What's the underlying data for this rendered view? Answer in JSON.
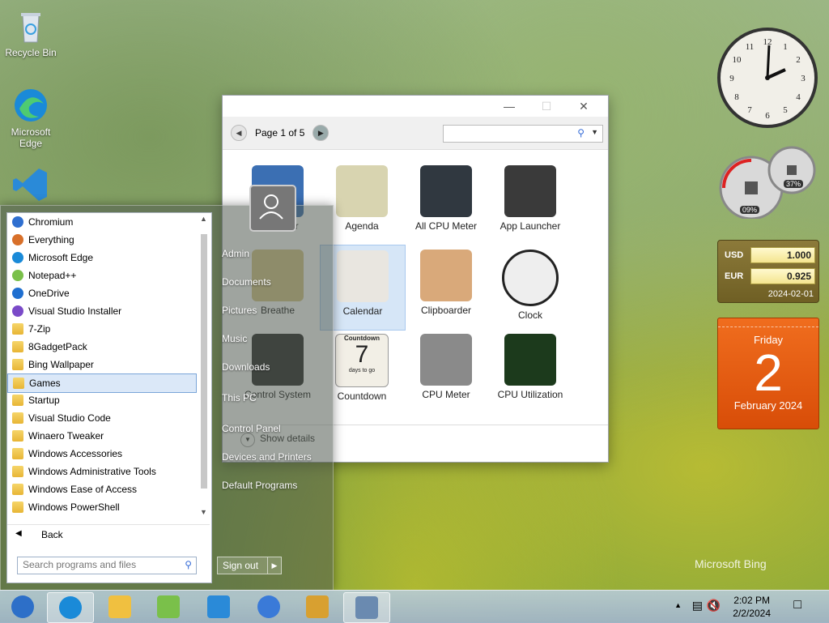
{
  "desktop": {
    "icons": [
      {
        "label": "Recycle Bin",
        "icon": "recycle-bin-icon"
      },
      {
        "label": "Microsoft Edge",
        "icon": "edge-icon"
      },
      {
        "label": "Visual Studio Code",
        "icon": "vscode-icon"
      }
    ],
    "watermark": "Microsoft Bing"
  },
  "gadget_window": {
    "pager": "Page 1 of 5",
    "search_placeholder": "",
    "show_details": "Show details",
    "gadgets": [
      {
        "label": "7 Sidebar",
        "icon": "sidebar-icon",
        "color": "#3b6fb3"
      },
      {
        "label": "Agenda",
        "icon": "agenda-icon",
        "color": "#d8d4b0"
      },
      {
        "label": "All CPU Meter",
        "icon": "cpu-meter-icon",
        "color": "#303840"
      },
      {
        "label": "App Launcher",
        "icon": "app-launcher-icon",
        "color": "#3a3a3a"
      },
      {
        "label": "Breathe",
        "icon": "breathe-icon",
        "color": "#d9c98a"
      },
      {
        "label": "Calendar",
        "icon": "calendar-icon",
        "color": "#e9e6e0"
      },
      {
        "label": "Clipboarder",
        "icon": "clipboarder-icon",
        "color": "#d9a97a"
      },
      {
        "label": "Clock",
        "icon": "clock-icon",
        "color": "#eeeeee"
      },
      {
        "label": "Control System",
        "icon": "control-system-icon",
        "color": "#2a2a2a"
      },
      {
        "label": "Countdown",
        "icon": "countdown-icon",
        "color": "#f2efe6"
      },
      {
        "label": "CPU Meter",
        "icon": "cpu-meter-round-icon",
        "color": "#8a8a8a"
      },
      {
        "label": "CPU Utilization",
        "icon": "cpu-utilization-icon",
        "color": "#1c3a1c"
      }
    ],
    "countdown_number": "7",
    "countdown_caption": "Countdown",
    "countdown_sub": "days to go"
  },
  "start_menu": {
    "programs": [
      {
        "label": "Chromium",
        "icon": "chromium-icon",
        "color": "#2f6fd0"
      },
      {
        "label": "Everything",
        "icon": "everything-icon",
        "color": "#d8702a"
      },
      {
        "label": "Microsoft Edge",
        "icon": "edge-icon",
        "color": "#1a8ad8"
      },
      {
        "label": "Notepad++",
        "icon": "notepadpp-icon",
        "color": "#7ac04a"
      },
      {
        "label": "OneDrive",
        "icon": "onedrive-icon",
        "color": "#1f6fd0"
      },
      {
        "label": "Visual Studio Installer",
        "icon": "vs-installer-icon",
        "color": "#7a4ac8"
      },
      {
        "label": "7-Zip",
        "icon": "folder-icon",
        "color": "folder"
      },
      {
        "label": "8GadgetPack",
        "icon": "folder-icon",
        "color": "folder"
      },
      {
        "label": "Bing Wallpaper",
        "icon": "folder-icon",
        "color": "folder"
      },
      {
        "label": "Games",
        "icon": "folder-icon",
        "color": "folder",
        "selected": true
      },
      {
        "label": "Startup",
        "icon": "folder-icon",
        "color": "folder"
      },
      {
        "label": "Visual Studio Code",
        "icon": "folder-icon",
        "color": "folder"
      },
      {
        "label": "Winaero Tweaker",
        "icon": "folder-icon",
        "color": "folder"
      },
      {
        "label": "Windows Accessories",
        "icon": "folder-icon",
        "color": "folder"
      },
      {
        "label": "Windows Administrative Tools",
        "icon": "folder-icon",
        "color": "folder"
      },
      {
        "label": "Windows Ease of Access",
        "icon": "folder-icon",
        "color": "folder"
      },
      {
        "label": "Windows PowerShell",
        "icon": "folder-icon",
        "color": "folder"
      }
    ],
    "back_label": "Back",
    "search_placeholder": "Search programs and files",
    "right_items": [
      "Admin",
      "Documents",
      "Pictures",
      "Music",
      "Downloads",
      "This PC",
      "Control Panel",
      "Devices and Printers",
      "Default Programs"
    ],
    "sign_out": "Sign out"
  },
  "side_gadgets": {
    "meter_left": "09%",
    "meter_right": "37%",
    "currency": [
      {
        "code": "USD",
        "value": "1.000"
      },
      {
        "code": "EUR",
        "value": "0.925"
      }
    ],
    "currency_date": "2024-02-01",
    "calendar": {
      "weekday": "Friday",
      "day": "2",
      "month_year": "February 2024"
    }
  },
  "taskbar": {
    "apps": [
      {
        "icon": "start-orb-icon",
        "color": "#2d6fc8"
      },
      {
        "icon": "edge-icon",
        "color": "#1a8ad8",
        "active": true
      },
      {
        "icon": "file-explorer-icon",
        "color": "#f0c040"
      },
      {
        "icon": "notepadpp-icon",
        "color": "#7ac04a"
      },
      {
        "icon": "vscode-icon",
        "color": "#2a8ad8"
      },
      {
        "icon": "chromium-icon",
        "color": "#3a7ad8"
      },
      {
        "icon": "bing-wallpaper-icon",
        "color": "#d8a030"
      },
      {
        "icon": "gadgets-icon",
        "color": "#6a8ab0",
        "active": true
      }
    ],
    "time": "2:02 PM",
    "date": "2/2/2024"
  }
}
